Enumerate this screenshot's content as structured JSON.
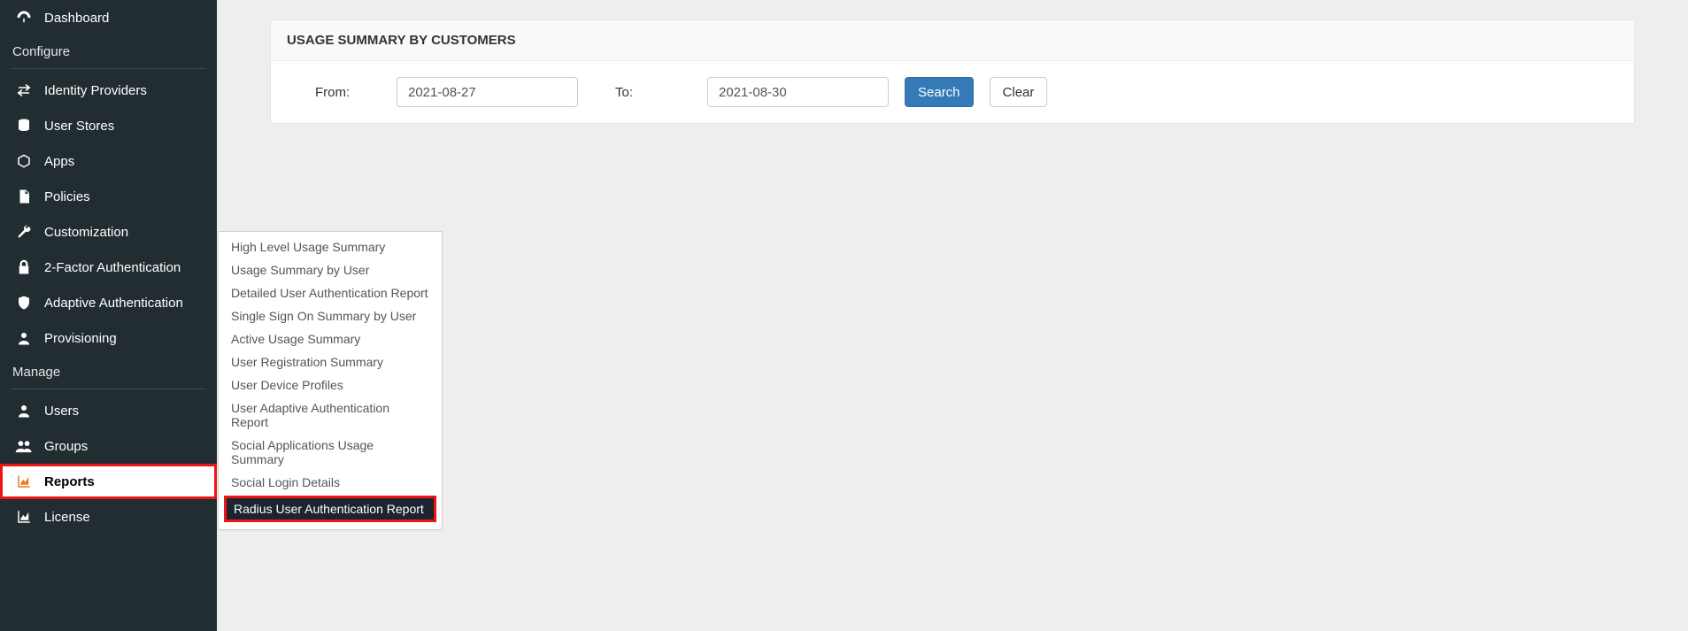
{
  "sidebar": {
    "items": [
      {
        "label": "Dashboard",
        "icon": "dashboard"
      },
      {
        "section": "Configure"
      },
      {
        "label": "Identity Providers",
        "icon": "exchange"
      },
      {
        "label": "User Stores",
        "icon": "database"
      },
      {
        "label": "Apps",
        "icon": "cube"
      },
      {
        "label": "Policies",
        "icon": "file"
      },
      {
        "label": "Customization",
        "icon": "wrench"
      },
      {
        "label": "2-Factor Authentication",
        "icon": "lock"
      },
      {
        "label": "Adaptive Authentication",
        "icon": "shield"
      },
      {
        "label": "Provisioning",
        "icon": "user"
      },
      {
        "section": "Manage"
      },
      {
        "label": "Users",
        "icon": "user"
      },
      {
        "label": "Groups",
        "icon": "users"
      },
      {
        "label": "Reports",
        "icon": "area-chart",
        "active": true
      },
      {
        "label": "License",
        "icon": "area-chart"
      }
    ]
  },
  "panel": {
    "title": "USAGE SUMMARY BY CUSTOMERS",
    "from_label": "From:",
    "to_label": "To:",
    "from_value": "2021-08-27",
    "to_value": "2021-08-30",
    "search_btn": "Search",
    "clear_btn": "Clear"
  },
  "submenu": {
    "items": [
      "High Level Usage Summary",
      "Usage Summary by User",
      "Detailed User Authentication Report",
      "Single Sign On Summary by User",
      "Active Usage Summary",
      "User Registration Summary",
      "User Device Profiles",
      "User Adaptive Authentication Report",
      "Social Applications Usage Summary",
      "Social Login Details",
      "Radius User Authentication Report"
    ],
    "highlighted_index": 10
  }
}
